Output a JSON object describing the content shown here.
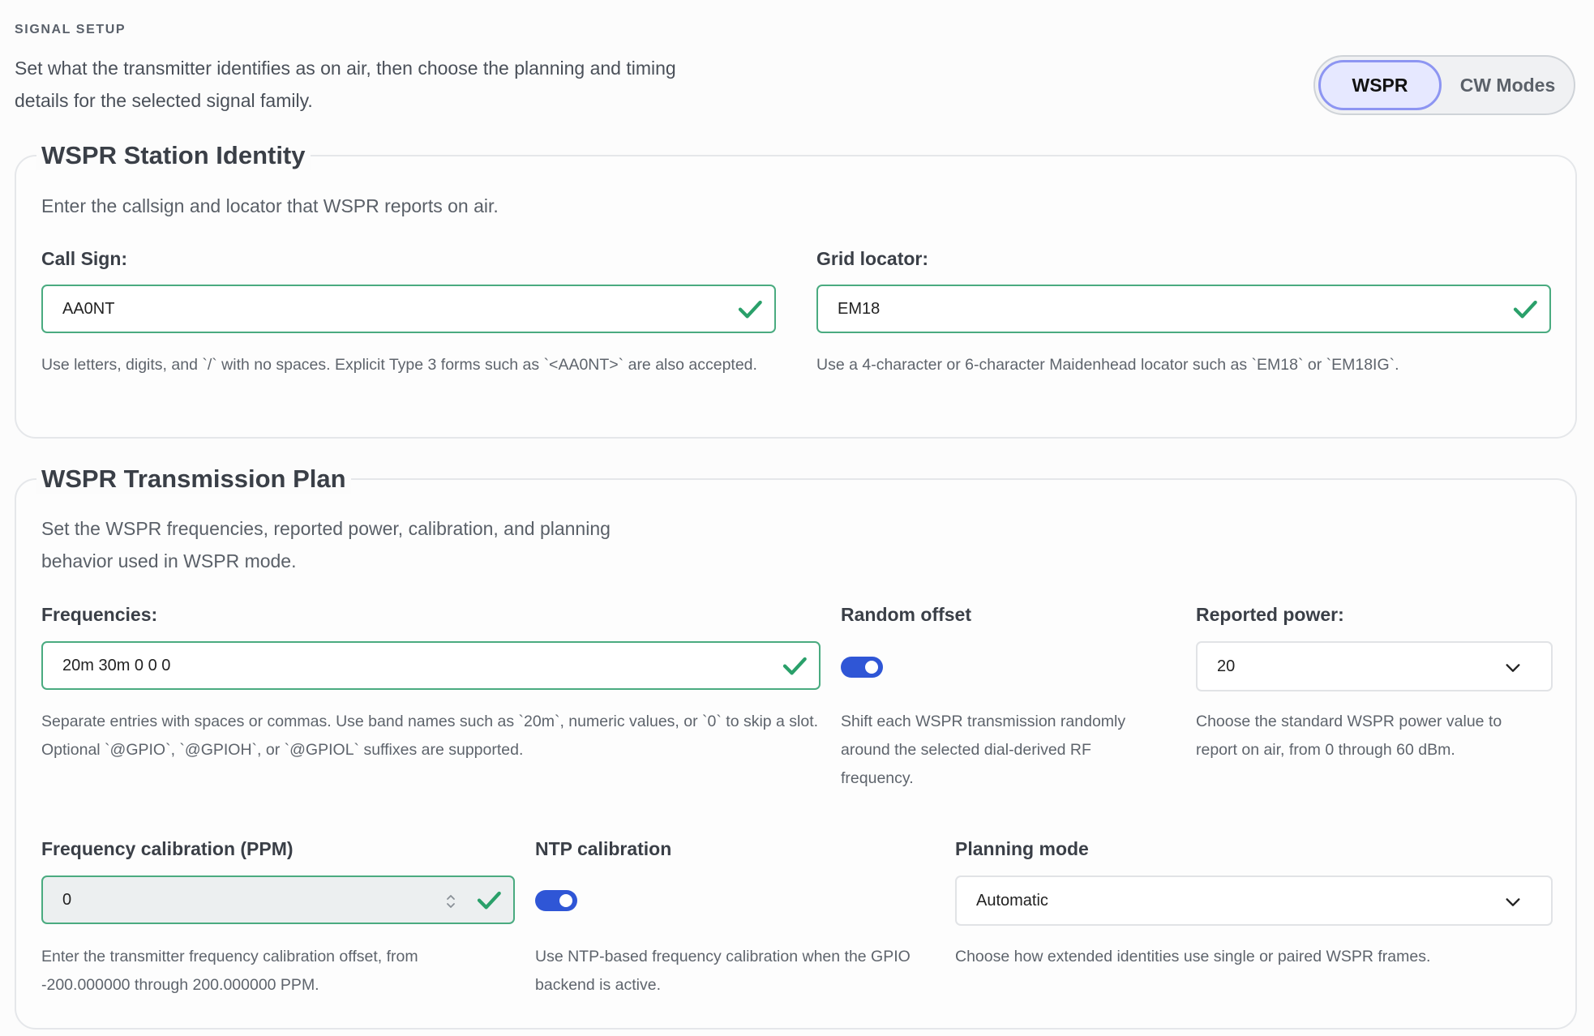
{
  "header": {
    "eyebrow": "SIGNAL SETUP",
    "intro": "Set what the transmitter identifies as on air, then choose the planning and timing details for the selected signal family."
  },
  "mode_switch": {
    "options": [
      {
        "label": "WSPR",
        "selected": true
      },
      {
        "label": "CW Modes",
        "selected": false
      }
    ]
  },
  "identity": {
    "title": "WSPR Station Identity",
    "description": "Enter the callsign and locator that WSPR reports on air.",
    "callsign": {
      "label": "Call Sign:",
      "value": "AA0NT",
      "help": "Use letters, digits, and `/` with no spaces. Explicit Type 3 forms such as `<AA0NT>` are also accepted."
    },
    "grid": {
      "label": "Grid locator:",
      "value": "EM18",
      "help": "Use a 4-character or 6-character Maidenhead locator such as `EM18` or `EM18IG`."
    }
  },
  "plan": {
    "title": "WSPR Transmission Plan",
    "description": "Set the WSPR frequencies, reported power, calibration, and planning behavior used in WSPR mode.",
    "frequencies": {
      "label": "Frequencies:",
      "value": "20m 30m 0 0 0",
      "help": "Separate entries with spaces or commas. Use band names such as `20m`, numeric values, or `0` to skip a slot. Optional `@GPIO`, `@GPIOH`, or `@GPIOL` suffixes are supported."
    },
    "random_offset": {
      "label": "Random offset",
      "enabled": true,
      "help": "Shift each WSPR transmission randomly around the selected dial-derived RF frequency."
    },
    "power": {
      "label": "Reported power:",
      "value": "20",
      "help": "Choose the standard WSPR power value to report on air, from 0 through 60 dBm."
    },
    "ppm": {
      "label": "Frequency calibration (PPM)",
      "value": "0",
      "help": "Enter the transmitter frequency calibration offset, from -200.000000 through 200.000000 PPM."
    },
    "ntp": {
      "label": "NTP calibration",
      "enabled": true,
      "help": "Use NTP-based frequency calibration when the GPIO backend is active."
    },
    "planning": {
      "label": "Planning mode",
      "value": "Automatic",
      "help": "Choose how extended identities use single or paired WSPR frames."
    }
  },
  "colors": {
    "accent": "#2f56d6",
    "valid": "#2aa06a",
    "segment_selected_bg": "#e6e8ff",
    "segment_selected_border": "#8d95f2"
  }
}
